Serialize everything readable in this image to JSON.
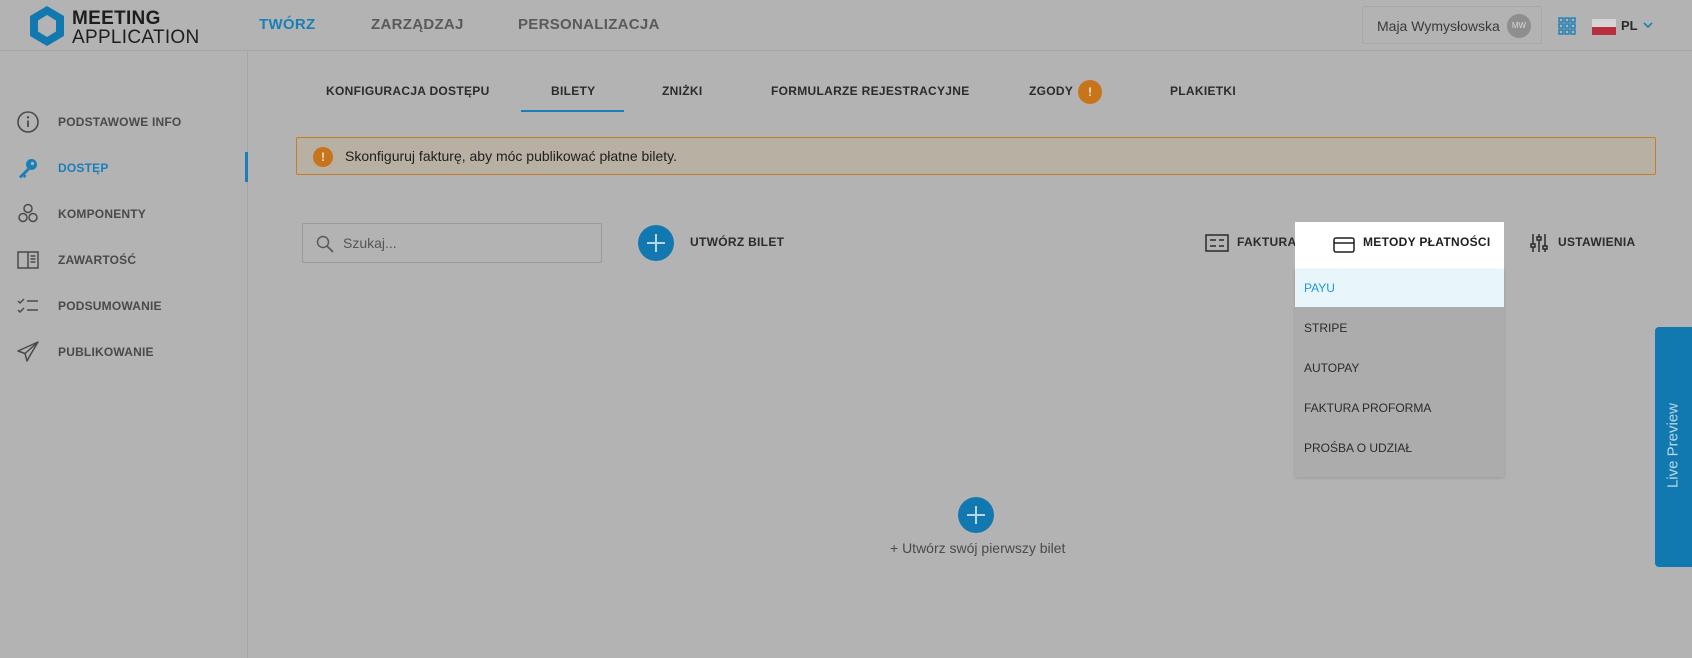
{
  "header": {
    "logo_line1": "MEETING",
    "logo_line2": "APPLICATION",
    "nav": [
      "TWÓRZ",
      "ZARZĄDZAJ",
      "PERSONALIZACJA"
    ],
    "active_nav": "TWÓRZ",
    "user_name": "Maja Wymysłowska",
    "user_initials": "MW",
    "language": "PL"
  },
  "sidebar": {
    "items": [
      {
        "label": "PODSTAWOWE INFO",
        "icon": "info-icon"
      },
      {
        "label": "DOSTĘP",
        "icon": "key-icon",
        "active": true
      },
      {
        "label": "KOMPONENTY",
        "icon": "components-icon"
      },
      {
        "label": "ZAWARTOŚĆ",
        "icon": "book-icon"
      },
      {
        "label": "PODSUMOWANIE",
        "icon": "checklist-icon"
      },
      {
        "label": "PUBLIKOWANIE",
        "icon": "paper-plane-icon"
      }
    ]
  },
  "tabs": {
    "items": [
      "KONFIGURACJA DOSTĘPU",
      "BILETY",
      "ZNIŻKI",
      "FORMULARZE REJESTRACYJNE",
      "ZGODY",
      "PLAKIETKI"
    ],
    "active": "BILETY",
    "warning_badge": "!"
  },
  "alert": {
    "icon": "!",
    "text": "Skonfiguruj fakturę, aby móc publikować płatne bilety."
  },
  "toolbar": {
    "search_placeholder": "Szukaj...",
    "create_label": "UTWÓRZ BILET",
    "invoice_label": "FAKTURA",
    "payment_methods_label": "METODY PŁATNOŚCI",
    "settings_label": "USTAWIENIA"
  },
  "payment_menu": {
    "options": [
      "PAYU",
      "STRIPE",
      "AUTOPAY",
      "FAKTURA PROFORMA",
      "PROŚBA O UDZIAŁ"
    ],
    "selected": "PAYU"
  },
  "empty_state": {
    "text": "+ Utwórz swój pierwszy bilet"
  },
  "live_preview": {
    "label": "Live Preview"
  },
  "colors": {
    "accent": "#1a7fb8",
    "warning": "#c7741a",
    "overlay_bg": "#b3b3b3",
    "selected_option_bg": "#e8f6fc"
  }
}
